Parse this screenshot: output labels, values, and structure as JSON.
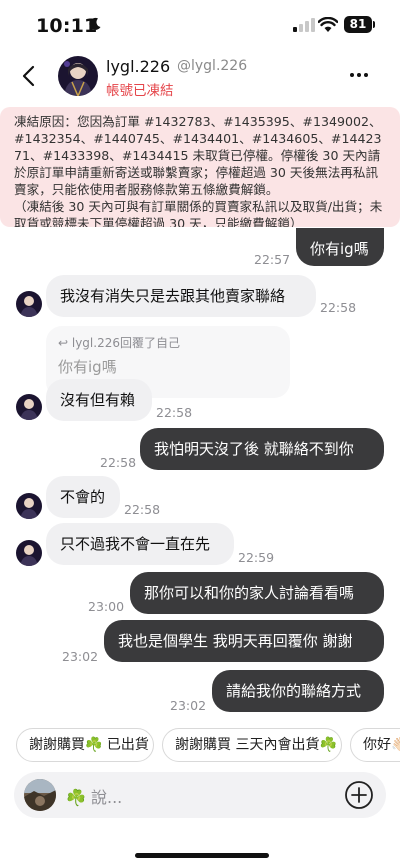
{
  "status_bar": {
    "time": "10:11",
    "battery": "81"
  },
  "header": {
    "name": "lygl.226",
    "handle": "@lygl.226",
    "account_status": "帳號已凍結"
  },
  "notice": {
    "text": "凍結原因：您因為訂單 #1432783、#1435395、#1349002、#1432354、#1440745、#1434401、#1434605、#1442371、#1433398、#1434415 未取貨已停權。停權後 30 天內請於原訂單申請重新寄送或聯繫賣家；停權超過 30 天後無法再私訊賣家，只能依使用者服務條款第五條繳費解鎖。\n（凍結後 30 天內可與有訂單關係的買賣家私訊以及取貨/出貨；未取貨或競標未下單停權超過 30 天，只能繳費解鎖）"
  },
  "messages": {
    "m1": {
      "text": "你有ig嗎",
      "time": "22:57"
    },
    "m2": {
      "text": "我沒有消失只是去跟其他賣家聯絡",
      "time": "22:58"
    },
    "m3_reply": {
      "header": "lygl.226回覆了自己",
      "quoted": "你有ig嗎"
    },
    "m3": {
      "text": "沒有但有賴",
      "time": "22:58"
    },
    "m4": {
      "text": "我怕明天沒了後 就聯絡不到你",
      "time": "22:58"
    },
    "m5": {
      "text": "不會的",
      "time": "22:58"
    },
    "m6": {
      "text": "只不過我不會一直在先",
      "time": "22:59"
    },
    "m7": {
      "text": "那你可以和你的家人討論看看嗎",
      "time": "23:00"
    },
    "m8": {
      "text": "我也是個學生 我明天再回覆你 謝謝",
      "time": "23:02"
    },
    "m9": {
      "text": "請給我你的聯絡方式",
      "time": "23:02"
    }
  },
  "quick_replies": [
    "謝謝購買☘️ 已出貨",
    "謝謝購買 三天內會出貨☘️",
    "你好👋🏻"
  ],
  "composer": {
    "placeholder": "☘️ 說..."
  },
  "colors": {
    "outgoing_bubble": "#3a3a3c",
    "incoming_bubble": "#f0f0f2",
    "alert_red": "#e5454a",
    "notice_bg": "#fbe4e5"
  }
}
